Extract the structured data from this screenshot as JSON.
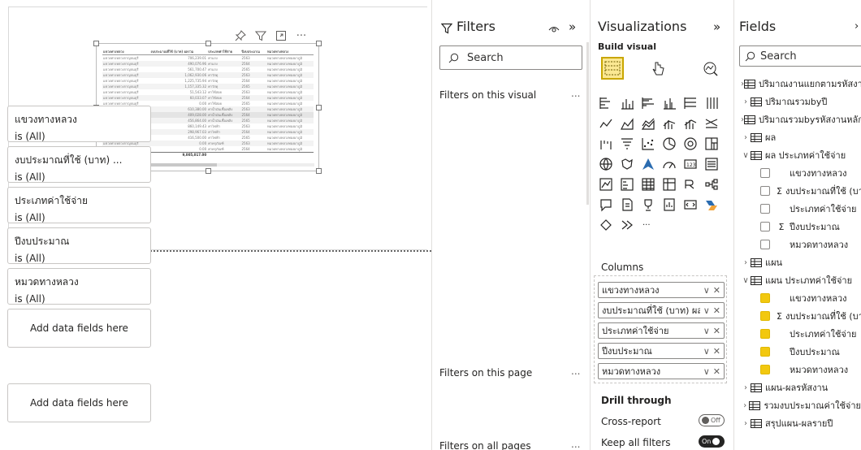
{
  "canvas": {
    "table": {
      "headers": [
        "แขวงทางหลวง",
        "งบประมาณที่ใช้ (บาท) ผลรวม",
        "ประเภทค่าใช้จ่าย",
        "ปีงบประมาณ",
        "หมวดทางหลวง"
      ],
      "rows": [
        [
          "แขวงทางหลวงกาญจนบุรี",
          "706,239.01",
          "ค่าแรง",
          "2563",
          "หมวดทางหลวงทองผาภูมิ"
        ],
        [
          "แขวงทางหลวงกาญจนบุรี",
          "490,076.96",
          "ค่าแรง",
          "2564",
          "หมวดทางหลวงทองผาภูมิ"
        ],
        [
          "แขวงทางหลวงกาญจนบุรี",
          "561,700.47",
          "ค่าแรง",
          "2565",
          "หมวดทางหลวงทองผาภูมิ"
        ],
        [
          "แขวงทางหลวงกาญจนบุรี",
          "1,062,930.06",
          "ค่าวัสดุ",
          "2563",
          "หมวดทางหลวงทองผาภูมิ"
        ],
        [
          "แขวงทางหลวงกาญจนบุรี",
          "1,225,735.94",
          "ค่าวัสดุ",
          "2564",
          "หมวดทางหลวงทองผาภูมิ"
        ],
        [
          "แขวงทางหลวงกาญจนบุรี",
          "1,157,335.32",
          "ค่าวัสดุ",
          "2565",
          "หมวดทางหลวงทองผาภูมิ"
        ],
        [
          "แขวงทางหลวงกาญจนบุรี",
          "51,543.12",
          "ค่าใช้สอย",
          "2563",
          "หมวดทางหลวงทองผาภูมิ"
        ],
        [
          "แขวงทางหลวงกาญจนบุรี",
          "60,033.07",
          "ค่าใช้สอย",
          "2564",
          "หมวดทางหลวงทองผาภูมิ"
        ],
        [
          "แขวงทางหลวงกาญจนบุรี",
          "0.00",
          "ค่าใช้สอย",
          "2565",
          "หมวดทางหลวงทองผาภูมิ"
        ],
        [
          "แขวงทางหลวงกาญจนบุรี",
          "610,380.00",
          "ค่าน้ำมันเชื้อเพลิง",
          "2563",
          "หมวดทางหลวงทองผาภูมิ"
        ],
        [
          "แขวงทางหลวงกาญจนบุรี",
          "409,028.00",
          "ค่าน้ำมันเชื้อเพลิง",
          "2564",
          "หมวดทางหลวงทองผาภูมิ"
        ],
        [
          "แขวงทางหลวงกาญจนบุรี",
          "456,864.00",
          "ค่าน้ำมันเชื้อเพลิง",
          "2565",
          "หมวดทางหลวงทองผาภูมิ"
        ],
        [
          "แขวงทางหลวงกาญจนบุรี",
          "860,149.43",
          "ค่าไฟฟ้า",
          "2563",
          "หมวดทางหลวงทองผาภูมิ"
        ],
        [
          "แขวงทางหลวงกาญจนบุรี",
          "298,967.03",
          "ค่าไฟฟ้า",
          "2564",
          "หมวดทางหลวงทองผาภูมิ"
        ],
        [
          "แขวงทางหลวงกาญจนบุรี",
          "416,500.00",
          "ค่าไฟฟ้า",
          "2565",
          "หมวดทางหลวงทองผาภูมิ"
        ],
        [
          "แขวงทางหลวงกาญจนบุรี",
          "0.00",
          "ค่าครุภัณฑ์",
          "2563",
          "หมวดทางหลวงทองผาภูมิ"
        ],
        [
          "แขวงทางหลวงกาญจนบุรี",
          "0.00",
          "ค่าครุภัณฑ์",
          "2564",
          "หมวดทางหลวงทองผาภูมิ"
        ]
      ],
      "total_label": "Total",
      "total_value": "9,005,017.00",
      "selected_row": 10
    }
  },
  "filters": {
    "title": "Filters",
    "search_placeholder": "Search",
    "on_visual_label": "Filters on this visual",
    "cards": [
      {
        "title": "แขวงทางหลวง",
        "state": "is (All)"
      },
      {
        "title": "งบประมาณที่ใช้ (บาท) ...",
        "state": "is (All)"
      },
      {
        "title": "ประเภทค่าใช้จ่าย",
        "state": "is (All)"
      },
      {
        "title": "ปีงบประมาณ",
        "state": "is (All)"
      },
      {
        "title": "หมวดทางหลวง",
        "state": "is (All)"
      }
    ],
    "add_data_label": "Add data fields here",
    "on_page_label": "Filters on this page",
    "add_data_label_page": "Add data fields here",
    "on_all_pages_label": "Filters on all pages",
    "more": "..."
  },
  "viz": {
    "title": "Visualizations",
    "build_visual": "Build visual",
    "columns_label": "Columns",
    "columns": [
      "แขวงทางหลวง",
      "งบประมาณที่ใช้ (บาท) ผลรวม",
      "ประเภทค่าใช้จ่าย",
      "ปีงบประมาณ",
      "หมวดทางหลวง"
    ],
    "drill_through": "Drill through",
    "cross_report": "Cross-report",
    "cross_report_state": "Off",
    "keep_all_filters": "Keep all filters",
    "keep_all_filters_state": "On",
    "more_visuals": "···"
  },
  "fields": {
    "title": "Fields",
    "search_placeholder": "Search",
    "items": [
      {
        "label": "ปริมาณงานแยกตามรหัสงาน",
        "expanded": false
      },
      {
        "label": "ปริมาณรวมbyปี",
        "expanded": false
      },
      {
        "label": "ปริมาณรวมbyรหัสงานหลัก",
        "expanded": false
      },
      {
        "label": "ผล",
        "expanded": false
      },
      {
        "label": "ผล ประเภทค่าใช้จ่าย",
        "expanded": true,
        "children": [
          {
            "label": "แขวงทางหลวง",
            "sigma": false,
            "checked": false
          },
          {
            "label": "งบประมาณที่ใช้ (บาท)",
            "sigma": true,
            "checked": false
          },
          {
            "label": "ประเภทค่าใช้จ่าย",
            "sigma": false,
            "checked": false
          },
          {
            "label": "ปีงบประมาณ",
            "sigma": true,
            "checked": false
          },
          {
            "label": "หมวดทางหลวง",
            "sigma": false,
            "checked": false
          }
        ]
      },
      {
        "label": "แผน",
        "expanded": false
      },
      {
        "label": "แผน ประเภทค่าใช้จ่าย",
        "expanded": true,
        "children": [
          {
            "label": "แขวงทางหลวง",
            "sigma": false,
            "checked": true
          },
          {
            "label": "งบประมาณที่ใช้ (บาท)",
            "sigma": true,
            "checked": true
          },
          {
            "label": "ประเภทค่าใช้จ่าย",
            "sigma": false,
            "checked": true
          },
          {
            "label": "ปีงบประมาณ",
            "sigma": false,
            "checked": true
          },
          {
            "label": "หมวดทางหลวง",
            "sigma": false,
            "checked": true
          }
        ]
      },
      {
        "label": "แผน-ผลรหัสงาน",
        "expanded": false
      },
      {
        "label": "รวมงบประมาณค่าใช้จ่าย",
        "expanded": false
      },
      {
        "label": "สรุปแผน-ผลรายปี",
        "expanded": false
      }
    ]
  },
  "colors": {
    "accent": "#f2c80f",
    "border": "#c8c6c4",
    "text": "#252423"
  }
}
